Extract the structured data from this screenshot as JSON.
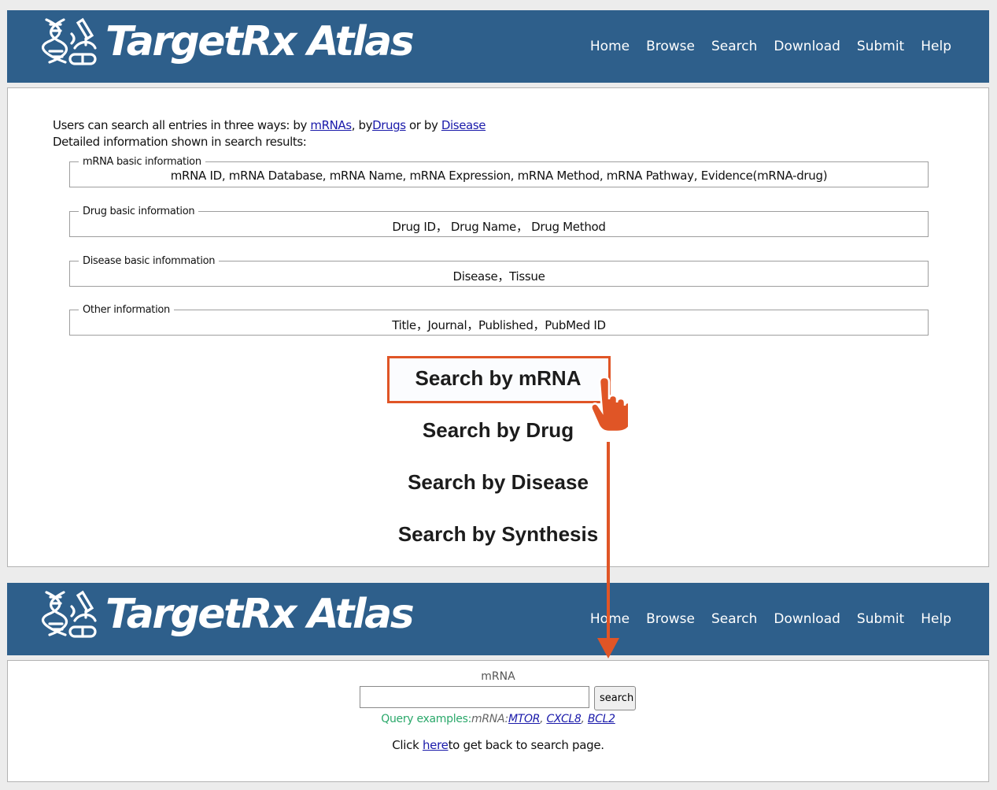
{
  "header": {
    "title": "TargetRx Atlas",
    "nav": [
      "Home",
      "Browse",
      "Search",
      "Download",
      "Submit",
      "Help"
    ]
  },
  "search_page": {
    "intro": {
      "prefix": "Users can search all entries in three ways: by ",
      "link_mrnas": "mRNAs",
      "sep1": ", by",
      "link_drugs": "Drugs",
      "sep2": " or by ",
      "link_disease": "Disease",
      "line2": "Detailed information shown in search results:"
    },
    "groups": [
      {
        "legend": "mRNA basic information",
        "fields": "mRNA ID, mRNA Database, mRNA Name, mRNA Expression, mRNA Method, mRNA Pathway, Evidence(mRNA-drug)"
      },
      {
        "legend": "Drug basic information",
        "fields": "Drug ID， Drug Name， Drug Method"
      },
      {
        "legend": "Disease basic infommation",
        "fields": "Disease，Tissue"
      },
      {
        "legend": "Other information",
        "fields": "Title，Journal，Published，PubMed ID"
      }
    ],
    "buttons": {
      "mrna": "Search by mRNA",
      "drug": "Search by Drug",
      "disease": "Search by Disease",
      "synthesis": "Search by Synthesis"
    }
  },
  "mrna_search": {
    "label": "mRNA",
    "input_value": "",
    "button": "search",
    "examples_label": "Query examples:",
    "examples_type": "mRNA:",
    "examples": [
      "MTOR",
      "CXCL8",
      "BCL2"
    ],
    "examples_sep": ", ",
    "back_prefix": "Click ",
    "back_link": "here",
    "back_suffix": "to get back to search page."
  },
  "colors": {
    "banner": "#2e5f8b",
    "highlight": "#e05526",
    "example_label": "#2aa86a",
    "link": "#1a1aaa"
  }
}
